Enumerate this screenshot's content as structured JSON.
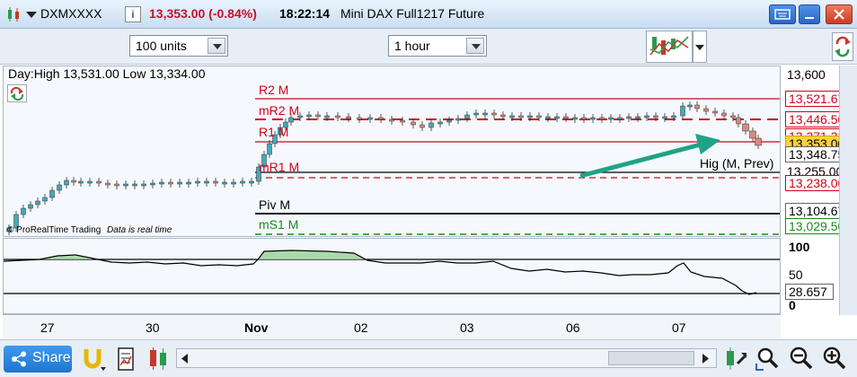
{
  "title_bar": {
    "symbol": "DXMXXXX",
    "info_icon": "i",
    "price": "13,353.00 (-0.84%)",
    "time": "18:22:14",
    "instrument": "Mini DAX Full1217 Future"
  },
  "toolbar": {
    "units": "100 units",
    "timeframe": "1 hour"
  },
  "chart": {
    "header_text": "Day:High 13,531.00 Low 13,334.00",
    "watermark": "© ProRealTime Trading",
    "realtime_note": "Data is real time",
    "arrow_label": "Hig (M, Prev)",
    "levels": [
      {
        "label": "R2 M",
        "value": "13,521.67",
        "color": "#d0021b"
      },
      {
        "label": "mR2 M",
        "value": "13,446.50",
        "color": "#d0021b"
      },
      {
        "label": "R1 M",
        "value": "13,371.33",
        "color": "#d0021b"
      },
      {
        "label": "mR1 M",
        "value": "13,238.00",
        "color": "#d0021b"
      },
      {
        "label": "Piv M",
        "value": "13,104.67",
        "color": "#000000"
      },
      {
        "label": "mS1 M",
        "value": "13,029.50",
        "color": "#1c8a1c"
      }
    ],
    "price_ticks": [
      "13,600",
      "13,255.00"
    ],
    "current_price": "13,353.00",
    "cursor_price": "13,348.75"
  },
  "indicator": {
    "ticks": [
      "100",
      "50",
      "0"
    ],
    "value": "28.657"
  },
  "x_axis": {
    "labels": [
      "27",
      "30",
      "Nov",
      "02",
      "03",
      "06",
      "07"
    ]
  },
  "bottom": {
    "share_label": "Share"
  },
  "colors": {
    "bull_candle": "#45a8b8",
    "bear_candle": "#d98b7a",
    "arrow": "#1fa387",
    "titlebar": "#d6e6f7"
  }
}
